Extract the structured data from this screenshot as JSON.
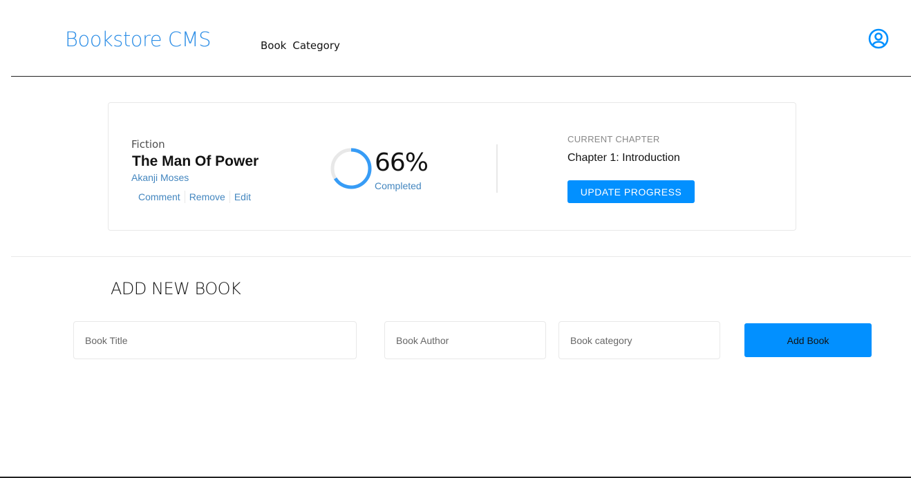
{
  "header": {
    "brand": "Bookstore CMS",
    "nav": [
      {
        "label": "Book"
      },
      {
        "label": "Category"
      }
    ],
    "user_icon": "user-circle-icon"
  },
  "book": {
    "genre": "Fiction",
    "title": "The Man Of Power",
    "author": "Akanji Moses",
    "actions": {
      "comment": "Comment",
      "remove": "Remove",
      "edit": "Edit"
    },
    "progress": {
      "percent_value": 66,
      "percent_text": "66%",
      "status": "Completed"
    },
    "chapter": {
      "label": "CURRENT CHAPTER",
      "name": "Chapter 1: Introduction",
      "update_label": "UPDATE PROGRESS"
    }
  },
  "form": {
    "title": "ADD NEW BOOK",
    "title_placeholder": "Book Title",
    "author_placeholder": "Book Author",
    "category_placeholder": "Book category",
    "submit_label": "Add Book"
  },
  "colors": {
    "accent": "#0290ff",
    "brand": "#2d8ee6",
    "link": "#4386bf",
    "ring_progress": "#379cf6",
    "ring_track": "#e8e8e8"
  }
}
